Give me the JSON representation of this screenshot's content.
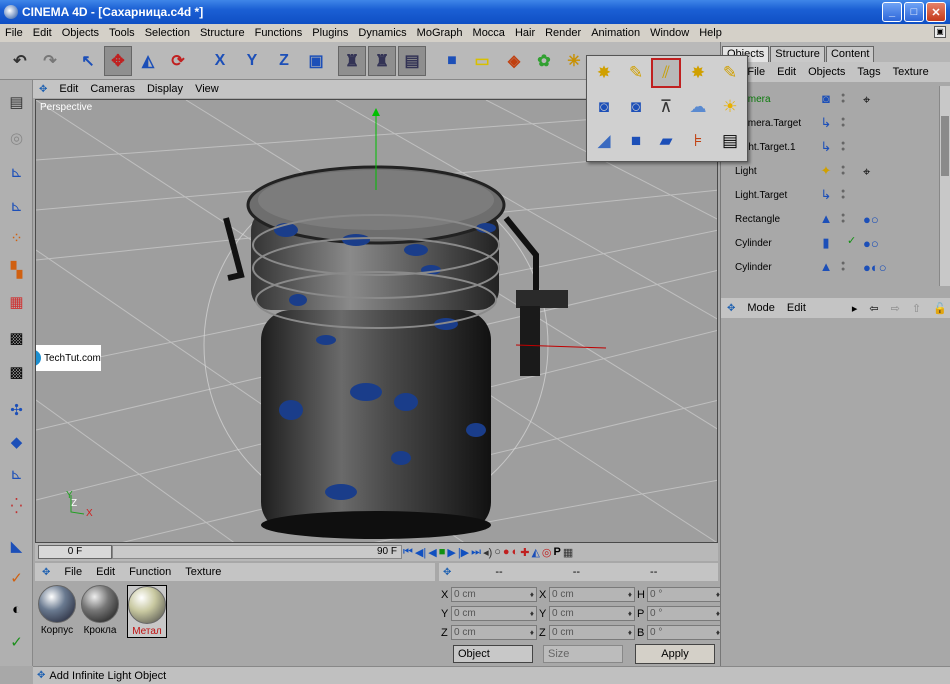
{
  "window": {
    "title": "CINEMA 4D - [Сахарница.c4d *]",
    "min": "_",
    "max": "□",
    "close": "✕"
  },
  "menu": [
    "File",
    "Edit",
    "Objects",
    "Tools",
    "Selection",
    "Structure",
    "Functions",
    "Plugins",
    "Dynamics",
    "MoGraph",
    "Mocca",
    "Hair",
    "Render",
    "Animation",
    "Window",
    "Help"
  ],
  "toolbar": [
    {
      "icon": "undo-icon",
      "glyph": "↶"
    },
    {
      "icon": "redo-icon",
      "glyph": "↷"
    },
    {
      "icon": "select-arrow-icon",
      "glyph": "↖"
    },
    {
      "icon": "move-icon",
      "glyph": "✥"
    },
    {
      "icon": "scale-icon",
      "glyph": "◭"
    },
    {
      "icon": "rotate-icon",
      "glyph": "⟳"
    },
    {
      "icon": "x-axis-icon",
      "glyph": "X"
    },
    {
      "icon": "y-axis-icon",
      "glyph": "Y"
    },
    {
      "icon": "z-axis-icon",
      "glyph": "Z"
    },
    {
      "icon": "world-coords-icon",
      "glyph": "▣"
    },
    {
      "icon": "render-view-icon",
      "glyph": "♜"
    },
    {
      "icon": "render-picture-icon",
      "glyph": "♜"
    },
    {
      "icon": "render-settings-icon",
      "glyph": "▤"
    },
    {
      "icon": "cube-icon",
      "glyph": "■"
    },
    {
      "icon": "spline-icon",
      "glyph": "▭"
    },
    {
      "icon": "nurbs-icon",
      "glyph": "◈"
    },
    {
      "icon": "deformer-icon",
      "glyph": "✿"
    },
    {
      "icon": "scene-light-icon",
      "glyph": "✳"
    }
  ],
  "left_tools": [
    "viewport-layout-icon",
    "model-mode-icon",
    "object-axis-icon",
    "points-mode-icon",
    "edges-mode-icon",
    "polygons-mode-icon",
    "uvw-mode-icon",
    "texture-mode-icon",
    "checker-icon",
    "axis-tweak-icon",
    "magnet-icon",
    "extrude-icon",
    "knife-icon",
    "smooth-icon",
    "paint-icon",
    "brush-icon",
    "render-region-icon",
    "keyframe-icon"
  ],
  "viewport": {
    "menu": [
      "Edit",
      "Cameras",
      "Display",
      "View"
    ],
    "label": "Perspective",
    "watermark": "TechTut.com",
    "axis": {
      "y": "Y",
      "z": "Z",
      "x": "X"
    }
  },
  "timeline": {
    "start": "0 F",
    "end": "90 F"
  },
  "materials": {
    "menu": [
      "File",
      "Edit",
      "Function",
      "Texture"
    ],
    "items": [
      {
        "name": "Корпус",
        "color": "#000000"
      },
      {
        "name": "Крокла",
        "color": "#000000"
      },
      {
        "name": "Метал",
        "color": "#c01010"
      }
    ]
  },
  "coords": {
    "header_a": "--",
    "header_b": "--",
    "header_c": "--",
    "rows": [
      {
        "l1": "X",
        "v1": "0 cm",
        "l2": "X",
        "v2": "0 cm",
        "l3": "H",
        "v3": "0 °"
      },
      {
        "l1": "Y",
        "v1": "0 cm",
        "l2": "Y",
        "v2": "0 cm",
        "l3": "P",
        "v3": "0 °"
      },
      {
        "l1": "Z",
        "v1": "0 cm",
        "l2": "Z",
        "v2": "0 cm",
        "l3": "B",
        "v3": "0 °"
      }
    ],
    "mode_select": "Object",
    "size_select": "Size",
    "apply": "Apply"
  },
  "status": "Add Infinite Light Object",
  "objects_panel": {
    "tabs": [
      "Objects",
      "Structure",
      "Content"
    ],
    "menu": [
      "File",
      "Edit",
      "Objects",
      "Tags",
      "Texture"
    ],
    "rows": [
      {
        "name": "Camera",
        "color": "#0a7a0a",
        "icon": "camera-icon",
        "glyph": "◙",
        "tag": "⌖"
      },
      {
        "name": "Camera.Target",
        "color": "#000000",
        "icon": "null-target-icon",
        "glyph": "↳",
        "tag": ""
      },
      {
        "name": "Light.Target.1",
        "color": "#000000",
        "icon": "null-target-icon",
        "glyph": "↳",
        "tag": ""
      },
      {
        "name": "Light",
        "color": "#000000",
        "icon": "light-icon",
        "glyph": "✦",
        "tag": "⌖"
      },
      {
        "name": "Light.Target",
        "color": "#000000",
        "icon": "null-target-icon",
        "glyph": "↳",
        "tag": ""
      },
      {
        "name": "Rectangle",
        "color": "#000000",
        "icon": "spline-icon",
        "glyph": "▲",
        "tag": "●○"
      },
      {
        "name": "Cylinder",
        "color": "#000000",
        "icon": "cylinder-icon",
        "glyph": "▮",
        "tag": "●○"
      },
      {
        "name": "Cylinder",
        "color": "#000000",
        "icon": "spline-icon",
        "glyph": "▲",
        "tag": "●◐○"
      }
    ]
  },
  "attributes": {
    "menu": [
      "Mode",
      "Edit"
    ]
  },
  "popup": [
    "light-omni-icon",
    "light-spot-icon",
    "light-infinite-icon",
    "light-area-icon",
    "light-spot-target-icon",
    "camera-icon",
    "camera-target-icon",
    "floor-icon",
    "sky-icon",
    "sun-icon",
    "background-icon",
    "foreground-icon",
    "stage-icon",
    "environment-icon",
    "clapper-icon"
  ]
}
